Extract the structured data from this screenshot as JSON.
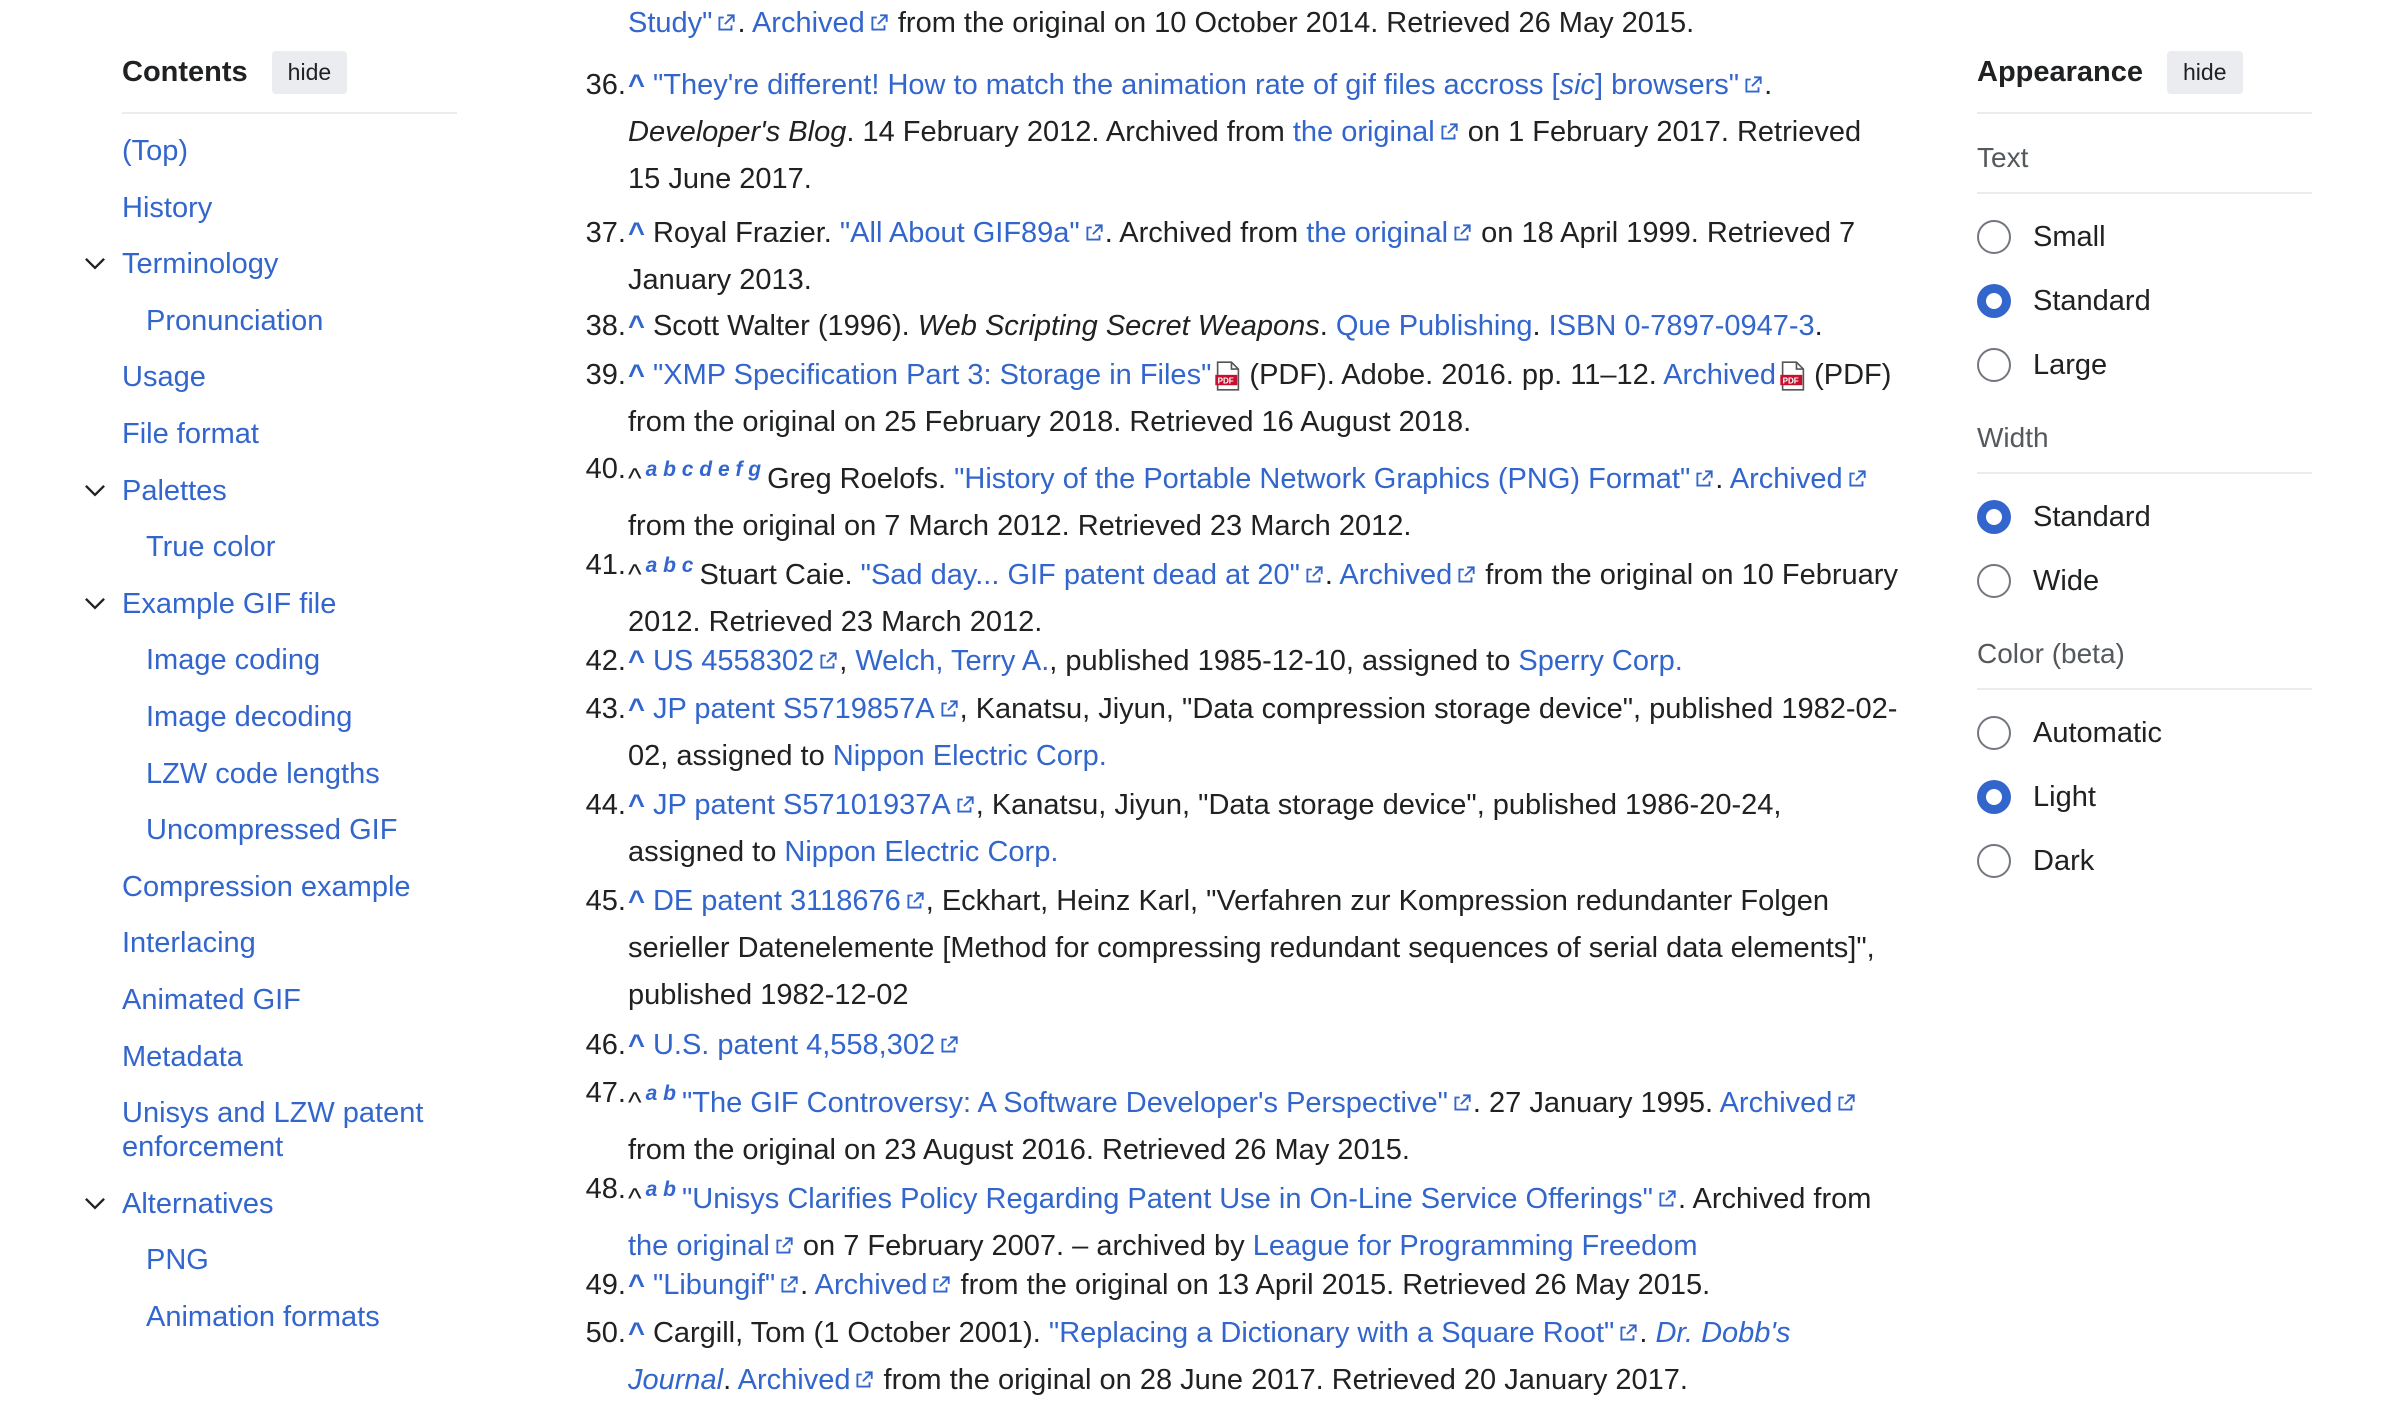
{
  "toc": {
    "title": "Contents",
    "hide_label": "hide",
    "items": [
      {
        "label": "(Top)",
        "sub": false,
        "chevron": false
      },
      {
        "label": "History",
        "sub": false,
        "chevron": false
      },
      {
        "label": "Terminology",
        "sub": false,
        "chevron": true
      },
      {
        "label": "Pronunciation",
        "sub": true,
        "chevron": false
      },
      {
        "label": "Usage",
        "sub": false,
        "chevron": false
      },
      {
        "label": "File format",
        "sub": false,
        "chevron": false
      },
      {
        "label": "Palettes",
        "sub": false,
        "chevron": true
      },
      {
        "label": "True color",
        "sub": true,
        "chevron": false
      },
      {
        "label": "Example GIF file",
        "sub": false,
        "chevron": true
      },
      {
        "label": "Image coding",
        "sub": true,
        "chevron": false
      },
      {
        "label": "Image decoding",
        "sub": true,
        "chevron": false
      },
      {
        "label": "LZW code lengths",
        "sub": true,
        "chevron": false
      },
      {
        "label": "Uncompressed GIF",
        "sub": true,
        "chevron": false
      },
      {
        "label": "Compression example",
        "sub": false,
        "chevron": false
      },
      {
        "label": "Interlacing",
        "sub": false,
        "chevron": false
      },
      {
        "label": "Animated GIF",
        "sub": false,
        "chevron": false
      },
      {
        "label": "Metadata",
        "sub": false,
        "chevron": false
      },
      {
        "label": "Unisys and LZW patent enforcement",
        "sub": false,
        "chevron": false
      },
      {
        "label": "Alternatives",
        "sub": false,
        "chevron": true
      },
      {
        "label": "PNG",
        "sub": true,
        "chevron": false
      },
      {
        "label": "Animation formats",
        "sub": true,
        "chevron": false
      }
    ]
  },
  "refs": {
    "r35": {
      "title_tail": "Study\"",
      "archived": "Archived",
      "text": " from the original on 10 October 2014. Retrieved 26 May 2015."
    },
    "r36": {
      "num": "36.",
      "caret": "^",
      "title_a": "\"They're different! How to match the animation rate of gif files accross [",
      "sic": "sic",
      "title_b": "] browsers\"",
      "t1": ". ",
      "journal": "Developer's Blog",
      "t2": ". 14 February 2012. Archived from ",
      "orig": "the original",
      "t3": " on 1 February 2017. Retrieved 15 June 2017."
    },
    "r37": {
      "num": "37.",
      "caret": "^",
      "t1": "Royal Frazier. ",
      "title": "\"All About GIF89a\"",
      "t2": ". Archived from ",
      "orig": "the original",
      "t3": " on 18 April 1999. Retrieved 7 January 2013."
    },
    "r38": {
      "num": "38.",
      "caret": "^",
      "t1": "Scott Walter (1996). ",
      "book": "Web Scripting Secret Weapons",
      "t2": ". ",
      "pub": "Que Publishing",
      "t3": ". ",
      "isbn": "ISBN 0-7897-0947-3",
      "t4": "."
    },
    "r39": {
      "num": "39.",
      "caret": "^",
      "title": "\"XMP Specification Part 3: Storage in Files\"",
      "t1": " (PDF). Adobe. 2016. pp. 11–12. ",
      "archived": "Archived",
      "t2": " (PDF) from the original on 25 February 2018. Retrieved 16 August 2018."
    },
    "r40": {
      "num": "40.",
      "caret": "^",
      "backlinks": "a b c d e f g",
      "t1": "Greg Roelofs. ",
      "title": "\"History of the Portable Network Graphics (PNG) Format\"",
      "t2": ". ",
      "archived": "Archived",
      "t3": " from the original on 7 March 2012. Retrieved 23 March 2012."
    },
    "r41": {
      "num": "41.",
      "caret": "^",
      "backlinks": "a b c",
      "t1": "Stuart Caie. ",
      "title": "\"Sad day... GIF patent dead at 20\"",
      "t2": ". ",
      "archived": "Archived",
      "t3": " from the original on 10 February 2012. Retrieved 23 March 2012."
    },
    "r42": {
      "num": "42.",
      "caret": "^",
      "patent": "US 4558302",
      "t1": ", ",
      "author": "Welch, Terry A.",
      "t2": ", published 1985-12-10, assigned to ",
      "assignee": "Sperry Corp."
    },
    "r43": {
      "num": "43.",
      "caret": "^",
      "patent": "JP patent S5719857A",
      "t1": ", Kanatsu, Jiyun, \"Data compression storage device\", published 1982-02-02, assigned to ",
      "assignee": "Nippon Electric Corp."
    },
    "r44": {
      "num": "44.",
      "caret": "^",
      "patent": "JP patent S57101937A",
      "t1": ", Kanatsu, Jiyun, \"Data storage device\", published 1986-20-24, assigned to ",
      "assignee": "Nippon Electric Corp."
    },
    "r45": {
      "num": "45.",
      "caret": "^",
      "patent": "DE patent 3118676",
      "t1": ", Eckhart, Heinz Karl, \"Verfahren zur Kompression redundanter Folgen serieller Datenelemente [Method for compressing redundant sequences of serial data elements]\", published 1982-12-02"
    },
    "r46": {
      "num": "46.",
      "caret": "^",
      "patent": "U.S. patent 4,558,302"
    },
    "r47": {
      "num": "47.",
      "caret": "^",
      "backlinks": "a b",
      "title": "\"The GIF Controversy: A Software Developer's Perspective\"",
      "t1": ". 27 January 1995. ",
      "archived": "Archived",
      "t2": " from the original on 23 August 2016. Retrieved 26 May 2015."
    },
    "r48": {
      "num": "48.",
      "caret": "^",
      "backlinks": "a b",
      "title": "\"Unisys Clarifies Policy Regarding Patent Use in On-Line Service Offerings\"",
      "t1": ". Archived from ",
      "orig": "the original",
      "t2": " on 7 February 2007. – archived by ",
      "org": "League for Programming Freedom"
    },
    "r49": {
      "num": "49.",
      "caret": "^",
      "title": "\"Libungif\"",
      "t1": ". ",
      "archived": "Archived",
      "t2": " from the original on 13 April 2015. Retrieved 26 May 2015."
    },
    "r50": {
      "num": "50.",
      "caret": "^",
      "t1": "Cargill, Tom (1 October 2001). ",
      "title": "\"Replacing a Dictionary with a Square Root\"",
      "t2": ". ",
      "journal": "Dr. Dobb's Journal",
      "t3": ". ",
      "archived": "Archived",
      "t4": " from the original on 28 June 2017. Retrieved 20 January 2017."
    }
  },
  "appearance": {
    "title": "Appearance",
    "hide_label": "hide",
    "text_label": "Text",
    "text_options": [
      "Small",
      "Standard",
      "Large"
    ],
    "text_selected": 1,
    "width_label": "Width",
    "width_options": [
      "Standard",
      "Wide"
    ],
    "width_selected": 0,
    "color_label": "Color (beta)",
    "color_options": [
      "Automatic",
      "Light",
      "Dark"
    ],
    "color_selected": 1
  },
  "colors": {
    "link": "#3366cc",
    "text": "#202122",
    "radio_on": "#3366cc",
    "divider": "#eaecf0"
  }
}
